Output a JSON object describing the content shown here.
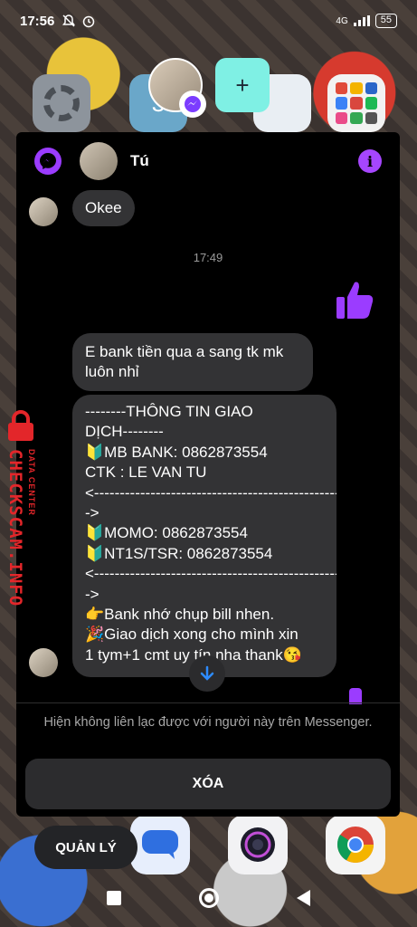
{
  "status_bar": {
    "time": "17:56",
    "network": "4G",
    "battery": "55"
  },
  "home": {
    "calendar_day": "3",
    "add_symbol": "+"
  },
  "watermark": {
    "brand": "CHECKSCAM.INFO",
    "tagline": "DATA CENTER"
  },
  "chat": {
    "contact_name": "Tú",
    "messages": [
      {
        "from": "contact",
        "text": "Okee"
      },
      {
        "from": "system",
        "text": "17:49"
      },
      {
        "from": "me",
        "text": "👍"
      },
      {
        "from": "contact",
        "text": "E bank tiền qua a sang tk mk\nluôn nhỉ"
      },
      {
        "from": "contact",
        "text": "--------THÔNG TIN GIAO\nDỊCH--------\n🔰MB BANK: 0862873554\nCTK : LE VAN TU\n<------------------------------------------------\n->\n🔰MOMO: 0862873554\n🔰NT1S/TSR: 0862873554\n<------------------------------------------------\n->\n👉Bank nhớ chụp bill nhen.\n🎉Giao dịch xong cho mình xin\n1 tym+1 cmt uy tín nha thank😘"
      }
    ],
    "unreachable_notice": "Hiện không liên lạc được với người này trên Messenger.",
    "delete_label": "XÓA"
  },
  "dock": {
    "manage_label": "QUẢN LÝ"
  },
  "colors": {
    "accent": "#9b3cff",
    "bubble": "#333335",
    "panel": "#000000",
    "watermark": "#e3262a"
  },
  "icons": [
    "settings-icon",
    "messenger-icon",
    "info-icon",
    "thumbs-up-icon",
    "arrow-down-icon",
    "messages-icon",
    "camera-icon",
    "chrome-icon",
    "lock-icon"
  ]
}
